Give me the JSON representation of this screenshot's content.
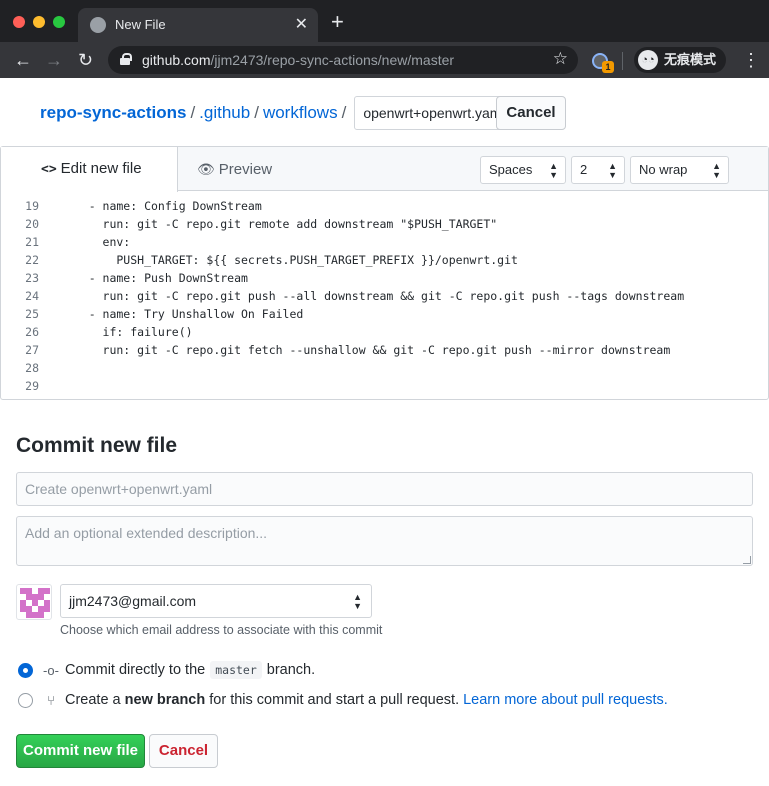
{
  "browser": {
    "tab_title": "New File",
    "new_tab_symbol": "+",
    "url_host": "github.com",
    "url_path": "/jjm2473/repo-sync-actions/new/master",
    "extension_badge": "1",
    "incognito_label": "无痕模式"
  },
  "breadcrumb": {
    "repo": "repo-sync-actions",
    "sep": "/",
    "dir1": ".github",
    "dir2": "workflows",
    "filename_value": "openwrt+openwrt.yaml",
    "cancel_label": "Cancel"
  },
  "editor": {
    "tab_edit_icon": "<>",
    "tab_edit_label": "Edit new file",
    "tab_preview_label": "Preview",
    "indent_mode": "Spaces",
    "indent_size": "2",
    "wrap_mode": "No wrap",
    "lines": [
      {
        "n": "19",
        "text": "    - name: Config DownStream"
      },
      {
        "n": "20",
        "text": "      run: git -C repo.git remote add downstream \"$PUSH_TARGET\""
      },
      {
        "n": "21",
        "text": "      env:"
      },
      {
        "n": "22",
        "text": "        PUSH_TARGET: ${{ secrets.PUSH_TARGET_PREFIX }}/openwrt.git"
      },
      {
        "n": "23",
        "text": "    - name: Push DownStream"
      },
      {
        "n": "24",
        "text": "      run: git -C repo.git push --all downstream && git -C repo.git push --tags downstream"
      },
      {
        "n": "25",
        "text": "    - name: Try Unshallow On Failed"
      },
      {
        "n": "26",
        "text": "      if: failure()"
      },
      {
        "n": "27",
        "text": "      run: git -C repo.git fetch --unshallow && git -C repo.git push --mirror downstream"
      },
      {
        "n": "28",
        "text": ""
      },
      {
        "n": "29",
        "text": ""
      }
    ]
  },
  "commit": {
    "title": "Commit new file",
    "summary_placeholder": "Create openwrt+openwrt.yaml",
    "description_placeholder": "Add an optional extended description...",
    "email": "jjm2473@gmail.com",
    "email_note": "Choose which email address to associate with this commit",
    "direct_prefix": "Commit directly to the",
    "direct_branch": "master",
    "direct_suffix": "branch.",
    "newbranch_prefix": "Create a",
    "newbranch_bold": "new branch",
    "newbranch_suffix": "for this commit and start a pull request.",
    "learn_more": "Learn more about pull requests.",
    "commit_button": "Commit new file",
    "cancel_button": "Cancel"
  },
  "colors": {
    "link": "#0366d6",
    "commit_green": "#28a745",
    "cancel_red": "#cb2431",
    "avatar_pink": "#d372c9"
  }
}
